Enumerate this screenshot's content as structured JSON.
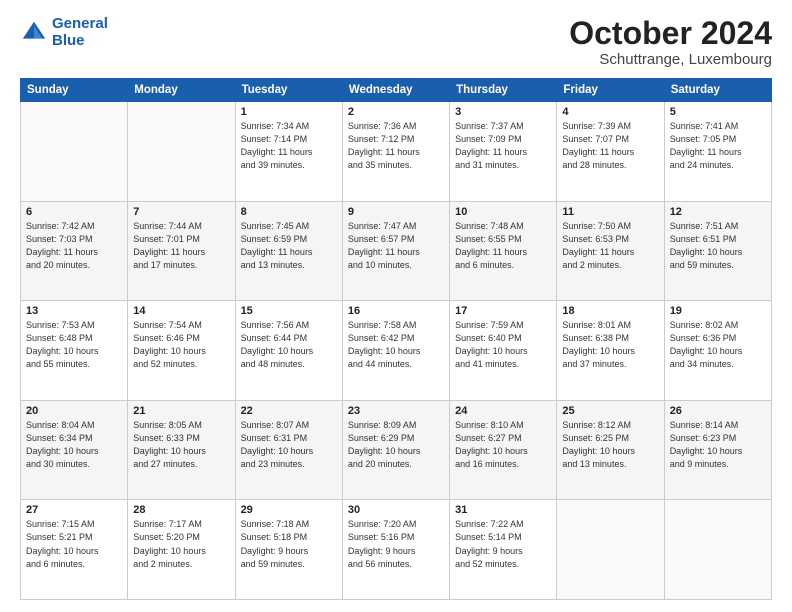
{
  "header": {
    "logo_line1": "General",
    "logo_line2": "Blue",
    "month_title": "October 2024",
    "location": "Schuttrange, Luxembourg"
  },
  "days_of_week": [
    "Sunday",
    "Monday",
    "Tuesday",
    "Wednesday",
    "Thursday",
    "Friday",
    "Saturday"
  ],
  "weeks": [
    [
      {
        "day": "",
        "info": ""
      },
      {
        "day": "",
        "info": ""
      },
      {
        "day": "1",
        "info": "Sunrise: 7:34 AM\nSunset: 7:14 PM\nDaylight: 11 hours\nand 39 minutes."
      },
      {
        "day": "2",
        "info": "Sunrise: 7:36 AM\nSunset: 7:12 PM\nDaylight: 11 hours\nand 35 minutes."
      },
      {
        "day": "3",
        "info": "Sunrise: 7:37 AM\nSunset: 7:09 PM\nDaylight: 11 hours\nand 31 minutes."
      },
      {
        "day": "4",
        "info": "Sunrise: 7:39 AM\nSunset: 7:07 PM\nDaylight: 11 hours\nand 28 minutes."
      },
      {
        "day": "5",
        "info": "Sunrise: 7:41 AM\nSunset: 7:05 PM\nDaylight: 11 hours\nand 24 minutes."
      }
    ],
    [
      {
        "day": "6",
        "info": "Sunrise: 7:42 AM\nSunset: 7:03 PM\nDaylight: 11 hours\nand 20 minutes."
      },
      {
        "day": "7",
        "info": "Sunrise: 7:44 AM\nSunset: 7:01 PM\nDaylight: 11 hours\nand 17 minutes."
      },
      {
        "day": "8",
        "info": "Sunrise: 7:45 AM\nSunset: 6:59 PM\nDaylight: 11 hours\nand 13 minutes."
      },
      {
        "day": "9",
        "info": "Sunrise: 7:47 AM\nSunset: 6:57 PM\nDaylight: 11 hours\nand 10 minutes."
      },
      {
        "day": "10",
        "info": "Sunrise: 7:48 AM\nSunset: 6:55 PM\nDaylight: 11 hours\nand 6 minutes."
      },
      {
        "day": "11",
        "info": "Sunrise: 7:50 AM\nSunset: 6:53 PM\nDaylight: 11 hours\nand 2 minutes."
      },
      {
        "day": "12",
        "info": "Sunrise: 7:51 AM\nSunset: 6:51 PM\nDaylight: 10 hours\nand 59 minutes."
      }
    ],
    [
      {
        "day": "13",
        "info": "Sunrise: 7:53 AM\nSunset: 6:48 PM\nDaylight: 10 hours\nand 55 minutes."
      },
      {
        "day": "14",
        "info": "Sunrise: 7:54 AM\nSunset: 6:46 PM\nDaylight: 10 hours\nand 52 minutes."
      },
      {
        "day": "15",
        "info": "Sunrise: 7:56 AM\nSunset: 6:44 PM\nDaylight: 10 hours\nand 48 minutes."
      },
      {
        "day": "16",
        "info": "Sunrise: 7:58 AM\nSunset: 6:42 PM\nDaylight: 10 hours\nand 44 minutes."
      },
      {
        "day": "17",
        "info": "Sunrise: 7:59 AM\nSunset: 6:40 PM\nDaylight: 10 hours\nand 41 minutes."
      },
      {
        "day": "18",
        "info": "Sunrise: 8:01 AM\nSunset: 6:38 PM\nDaylight: 10 hours\nand 37 minutes."
      },
      {
        "day": "19",
        "info": "Sunrise: 8:02 AM\nSunset: 6:36 PM\nDaylight: 10 hours\nand 34 minutes."
      }
    ],
    [
      {
        "day": "20",
        "info": "Sunrise: 8:04 AM\nSunset: 6:34 PM\nDaylight: 10 hours\nand 30 minutes."
      },
      {
        "day": "21",
        "info": "Sunrise: 8:05 AM\nSunset: 6:33 PM\nDaylight: 10 hours\nand 27 minutes."
      },
      {
        "day": "22",
        "info": "Sunrise: 8:07 AM\nSunset: 6:31 PM\nDaylight: 10 hours\nand 23 minutes."
      },
      {
        "day": "23",
        "info": "Sunrise: 8:09 AM\nSunset: 6:29 PM\nDaylight: 10 hours\nand 20 minutes."
      },
      {
        "day": "24",
        "info": "Sunrise: 8:10 AM\nSunset: 6:27 PM\nDaylight: 10 hours\nand 16 minutes."
      },
      {
        "day": "25",
        "info": "Sunrise: 8:12 AM\nSunset: 6:25 PM\nDaylight: 10 hours\nand 13 minutes."
      },
      {
        "day": "26",
        "info": "Sunrise: 8:14 AM\nSunset: 6:23 PM\nDaylight: 10 hours\nand 9 minutes."
      }
    ],
    [
      {
        "day": "27",
        "info": "Sunrise: 7:15 AM\nSunset: 5:21 PM\nDaylight: 10 hours\nand 6 minutes."
      },
      {
        "day": "28",
        "info": "Sunrise: 7:17 AM\nSunset: 5:20 PM\nDaylight: 10 hours\nand 2 minutes."
      },
      {
        "day": "29",
        "info": "Sunrise: 7:18 AM\nSunset: 5:18 PM\nDaylight: 9 hours\nand 59 minutes."
      },
      {
        "day": "30",
        "info": "Sunrise: 7:20 AM\nSunset: 5:16 PM\nDaylight: 9 hours\nand 56 minutes."
      },
      {
        "day": "31",
        "info": "Sunrise: 7:22 AM\nSunset: 5:14 PM\nDaylight: 9 hours\nand 52 minutes."
      },
      {
        "day": "",
        "info": ""
      },
      {
        "day": "",
        "info": ""
      }
    ]
  ]
}
